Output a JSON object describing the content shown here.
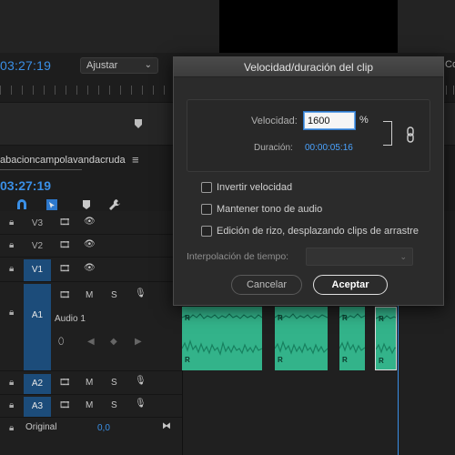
{
  "program": {
    "timecode": "03:27:19",
    "fit_select": "Ajustar",
    "right_truncated": "Co"
  },
  "sequence": {
    "title": "abacioncampolavandacruda",
    "menu_icon": "hamburger-icon",
    "timecode": "03:27:19"
  },
  "tracks": {
    "video": [
      {
        "name": "V3"
      },
      {
        "name": "V2"
      },
      {
        "name": "V1",
        "selected": true
      }
    ],
    "audio_main": {
      "name": "A1",
      "label": "Audio 1",
      "m": "M",
      "s": "S"
    },
    "audio": [
      {
        "name": "A2",
        "m": "M",
        "s": "S"
      },
      {
        "name": "A3",
        "m": "M",
        "s": "S"
      }
    ],
    "master": {
      "label": "Original",
      "value": "0,0"
    }
  },
  "clips": {
    "label": "R"
  },
  "dialog": {
    "title": "Velocidad/duración del clip",
    "speed_label": "Velocidad:",
    "speed_value": "1600",
    "speed_unit": "%",
    "duration_label": "Duración:",
    "duration_value": "00:00:05:16",
    "checkboxes": [
      {
        "label": "Invertir velocidad",
        "checked": false
      },
      {
        "label": "Mantener tono de audio",
        "checked": false
      },
      {
        "label": "Edición de rizo, desplazando clips de arrastre",
        "checked": false
      }
    ],
    "interp_label": "Interpolación de tiempo:",
    "interp_value": "",
    "cancel_label": "Cancelar",
    "ok_label": "Aceptar"
  },
  "colors": {
    "accent_blue": "#3a8fe6",
    "track_selected": "#1c4c7a",
    "clip_green": "#33b38a"
  }
}
